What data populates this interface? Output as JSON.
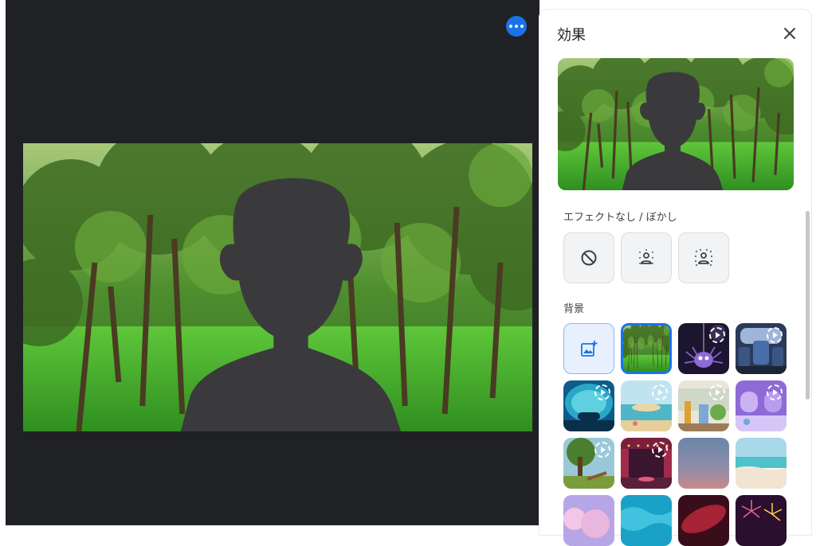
{
  "panel": {
    "title": "効果",
    "close_icon": "close-icon",
    "sections": {
      "no_effect_blur": "エフェクトなし / ぼかし",
      "background": "背景"
    }
  },
  "effects": [
    {
      "name": "no-effect",
      "icon": "block-icon"
    },
    {
      "name": "slight-blur",
      "icon": "person-blur-light-icon"
    },
    {
      "name": "blur",
      "icon": "person-blur-strong-icon"
    }
  ],
  "backgrounds": [
    {
      "name": "upload-background",
      "icon": "add-photo-icon"
    },
    {
      "name": "forest",
      "selected": true
    },
    {
      "name": "spider",
      "animated": true
    },
    {
      "name": "spaceship-seats",
      "animated": true
    },
    {
      "name": "underwater-dome",
      "animated": true
    },
    {
      "name": "beach-island",
      "animated": true
    },
    {
      "name": "garden-party",
      "animated": true
    },
    {
      "name": "purple-space-room",
      "animated": true
    },
    {
      "name": "tree-swing",
      "animated": true
    },
    {
      "name": "theater-stage",
      "animated": true
    },
    {
      "name": "sunset-gradient"
    },
    {
      "name": "beach"
    },
    {
      "name": "pink-clouds"
    },
    {
      "name": "ocean-water"
    },
    {
      "name": "red-nebula"
    },
    {
      "name": "fireworks"
    }
  ],
  "colors": {
    "stage": "#202124",
    "accent": "#1a73e8",
    "silhouette": "#3a3a3c"
  }
}
